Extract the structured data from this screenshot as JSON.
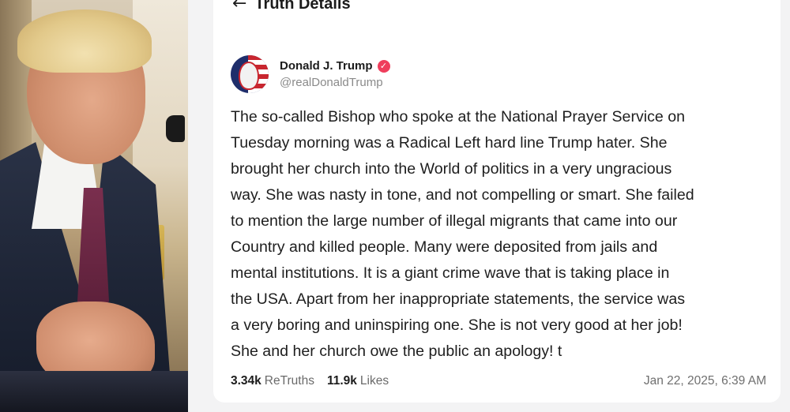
{
  "header": {
    "back_icon": "arrow-left-icon",
    "title": "Truth Details"
  },
  "author": {
    "avatar_icon": "avatar-flag-portrait",
    "name": "Donald J. Trump",
    "verified_icon": "verified-badge-icon",
    "handle": "@realDonaldTrump"
  },
  "post": {
    "lines": [
      "The so-called Bishop who spoke at the National Prayer Service on",
      "Tuesday morning was a Radical Left hard line Trump hater. She",
      "brought her church into the World of politics in a very ungracious",
      "way. She was nasty in tone, and not compelling or smart. She failed",
      "to mention the large number of illegal migrants that came into our",
      "Country and killed people. Many were deposited from jails and",
      "mental institutions. It is a giant crime wave that is taking place in",
      "the USA. Apart from her inappropriate statements, the service was",
      "a very boring and uninspiring one. She is not very good at her job!",
      "She and her church owe the public an apology! t"
    ]
  },
  "stats": {
    "retruths_count": "3.34k",
    "retruths_label": "ReTruths",
    "likes_count": "11.9k",
    "likes_label": "Likes"
  },
  "timestamp": "Jan 22, 2025, 6:39 AM",
  "colors": {
    "verified": "#ef3e5c",
    "text": "#1e1e1e",
    "muted": "#8a8a8a"
  }
}
